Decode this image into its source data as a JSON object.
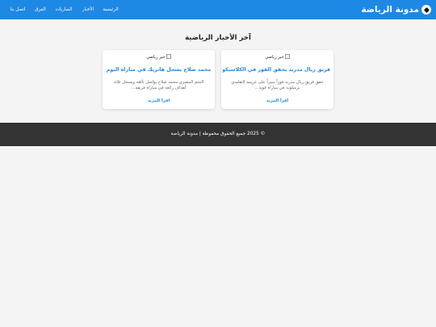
{
  "header": {
    "brand_title": "مدونة الرياضة",
    "nav_items": [
      {
        "label": "الرئيسية"
      },
      {
        "label": "الأخبار"
      },
      {
        "label": "المباريات"
      },
      {
        "label": "الفرق"
      },
      {
        "label": "اتصل بنا"
      }
    ]
  },
  "main": {
    "section_title": "آخر الأخبار الرياضية",
    "articles": [
      {
        "image_alt": "خبر رياضي",
        "title": "فريق ريال مدريد يحقق الفوز في الكلاسيكو",
        "excerpt": "حقق فريق ريال مدريد فوزاً مثيراً على غريمه التقليدي برشلونة في مباراة قوية...",
        "read_more": "اقرأ المزيد"
      },
      {
        "image_alt": "خبر رياضي",
        "title": "محمد صلاح يسجل هاتريك في مباراة اليوم",
        "excerpt": "النجم المصري محمد صلاح يواصل تألقه ويسجل ثلاثة أهداف رائعة في مباراة فريقه...",
        "read_more": "اقرأ المزيد"
      }
    ]
  },
  "footer": {
    "copyright": "© 2025 جميع الحقوق محفوظة | مدونة الرياضة"
  },
  "colors": {
    "header_bg": "#1e88e5",
    "accent": "#1e88e5",
    "page_bg": "#f4f4f4",
    "footer_bg": "#333333"
  },
  "icons": {
    "brand": "soccer-ball-icon",
    "article_image": "broken-image-icon"
  }
}
